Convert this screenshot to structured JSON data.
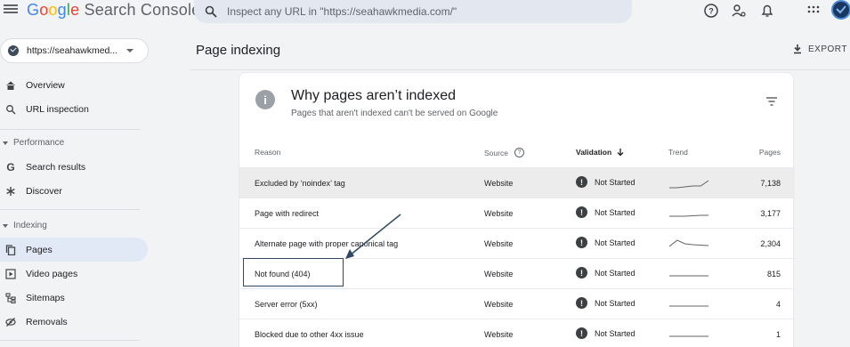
{
  "app": {
    "logo_google": [
      "G",
      "o",
      "o",
      "g",
      "l",
      "e"
    ],
    "logo_product": "Search Console",
    "search_placeholder": "Inspect any URL in \"https://seahawkmedia.com/\""
  },
  "top_icons": [
    "help-icon",
    "user-admin-icon",
    "bell-icon",
    "apps-grid-icon"
  ],
  "property": {
    "label": "https://seahawkmed..."
  },
  "sidebar": {
    "items": [
      {
        "label": "Overview",
        "icon": "home-icon",
        "glyph": "⌂"
      },
      {
        "label": "URL inspection",
        "icon": "search-icon",
        "glyph": "⌕"
      }
    ],
    "section_performance": "Performance",
    "performance_items": [
      {
        "label": "Search results",
        "icon": "google-g-icon",
        "glyph": "G"
      },
      {
        "label": "Discover",
        "icon": "asterisk-icon",
        "glyph": "✳"
      }
    ],
    "section_indexing": "Indexing",
    "indexing_items": [
      {
        "label": "Pages",
        "icon": "pages-icon",
        "glyph": "❐",
        "active": true
      },
      {
        "label": "Video pages",
        "icon": "video-pages-icon",
        "glyph": "▣"
      },
      {
        "label": "Sitemaps",
        "icon": "sitemap-icon",
        "glyph": "☷"
      },
      {
        "label": "Removals",
        "icon": "removals-icon",
        "glyph": "⦸"
      }
    ]
  },
  "page": {
    "title": "Page indexing",
    "export_label": "EXPORT"
  },
  "card": {
    "title": "Why pages aren’t indexed",
    "subtitle": "Pages that aren't indexed can't be served on Google",
    "columns": {
      "reason": "Reason",
      "source": "Source",
      "validation": "Validation",
      "trend": "Trend",
      "pages": "Pages"
    },
    "rows": [
      {
        "reason": "Excluded by ‘noindex’ tag",
        "source": "Website",
        "validation": "Not Started",
        "pages": "7,138",
        "trend": [
          0,
          0,
          0.1,
          0.2,
          0.2,
          0.8
        ],
        "highlight": true
      },
      {
        "reason": "Page with redirect",
        "source": "Website",
        "validation": "Not Started",
        "pages": "3,177",
        "trend": [
          0.2,
          0.2,
          0.2,
          0.25,
          0.3,
          0.3
        ]
      },
      {
        "reason": "Alternate page with proper canonical tag",
        "source": "Website",
        "validation": "Not Started",
        "pages": "2,304",
        "trend": [
          0.2,
          0.9,
          0.5,
          0.4,
          0.35,
          0.3
        ]
      },
      {
        "reason": "Not found (404)",
        "source": "Website",
        "validation": "Not Started",
        "pages": "815",
        "trend": [
          0.3,
          0.3,
          0.3,
          0.3,
          0.3,
          0.3
        ]
      },
      {
        "reason": "Server error (5xx)",
        "source": "Website",
        "validation": "Not Started",
        "pages": "4",
        "trend": [
          0.3,
          0.3,
          0.3,
          0.3,
          0.3,
          0.3
        ]
      },
      {
        "reason": "Blocked due to other 4xx issue",
        "source": "Website",
        "validation": "Not Started",
        "pages": "1",
        "trend": [
          0.3,
          0.3,
          0.3,
          0.3,
          0.3,
          0.3
        ]
      }
    ]
  },
  "colors": {
    "accent_active": "#e1e9f7",
    "row_highlight": "#ececec",
    "callout": "#2f4862"
  }
}
